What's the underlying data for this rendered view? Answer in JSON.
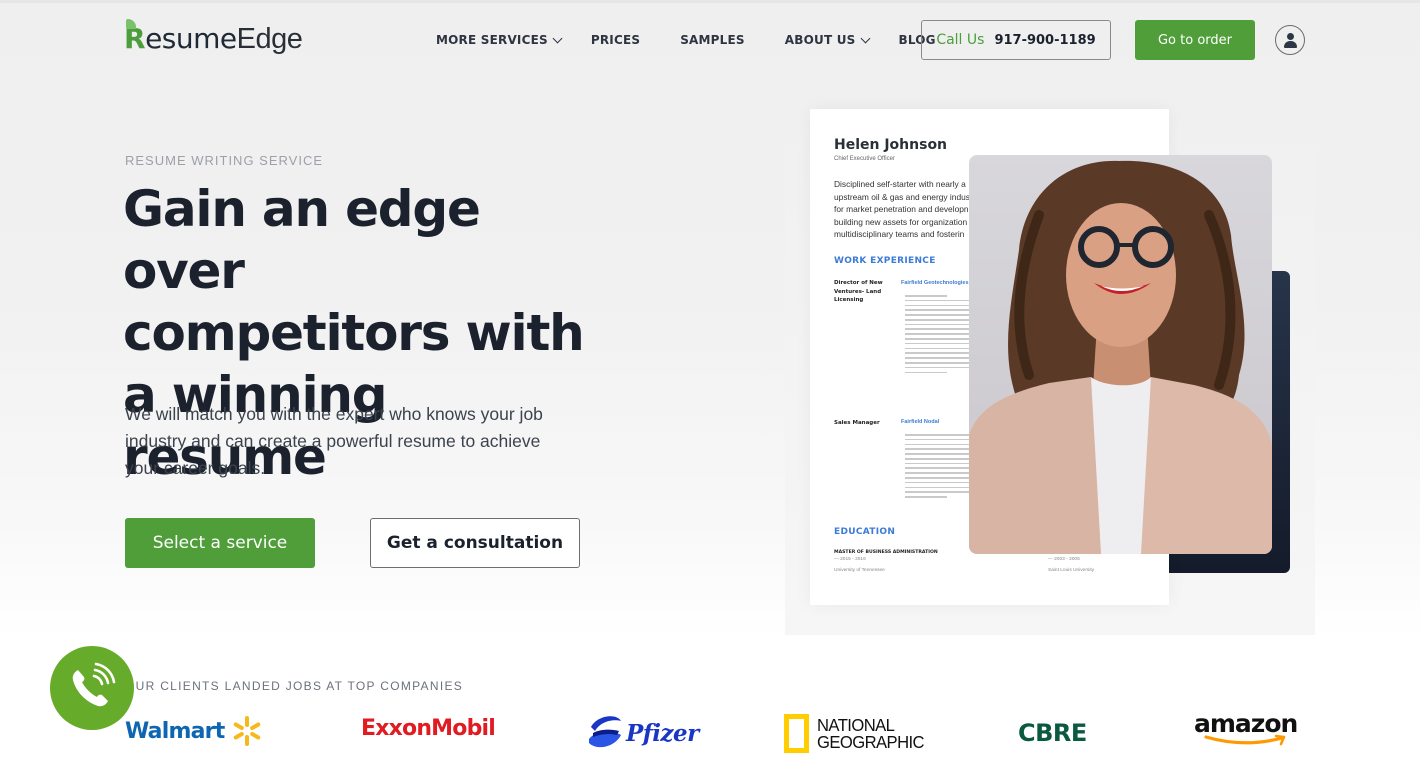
{
  "header": {
    "logo": {
      "r": "R",
      "esume": "esume",
      "edge": "Edge"
    },
    "nav": [
      {
        "label": "MORE SERVICES",
        "has_dropdown": true
      },
      {
        "label": "PRICES",
        "has_dropdown": false
      },
      {
        "label": "SAMPLES",
        "has_dropdown": false
      },
      {
        "label": "ABOUT US",
        "has_dropdown": true
      },
      {
        "label": "BLOG",
        "has_dropdown": false
      }
    ],
    "call": {
      "label": "Call Us",
      "phone": "917-900-1189"
    },
    "order_label": "Go to order",
    "user_icon": "user-icon"
  },
  "hero": {
    "eyebrow": "RESUME WRITING SERVICE",
    "title_lines": [
      "Gain an edge over",
      "competitors with",
      "a winning resume"
    ],
    "subtitle": "We will match you with the expert who knows your job industry and can create a powerful resume to achieve your career goals.",
    "primary_cta": "Select a service",
    "secondary_cta": "Get a consultation"
  },
  "resume_sample": {
    "name": "Helen Johnson",
    "role": "Chief Executive Officer",
    "summary": "Disciplined self-starter with nearly a\nupstream oil & gas and energy indus\nfor market penetration and developn\nbuilding new assets for organization\nmultidisciplinary teams and fosterin",
    "work_heading": "WORK EXPERIENCE",
    "jobs": [
      {
        "title": "Director of New Ventures- Land Licensing",
        "company": "Fairfield Geotechnologies"
      },
      {
        "title": "Sales Manager",
        "company": "Fairfield Nodal"
      }
    ],
    "education_heading": "EDUCATION",
    "education": [
      {
        "degree": "MASTER OF BUSINESS ADMINISTRATION",
        "years": "— 2015 - 2016",
        "school": "University of Tennessee"
      },
      {
        "degree": "",
        "years": "— 2003 - 2006",
        "school": "Saint Louis University"
      }
    ]
  },
  "clients": {
    "label": "OUR CLIENTS LANDED JOBS AT TOP COMPANIES",
    "logos": [
      {
        "name": "Walmart",
        "color": "#0e66b2"
      },
      {
        "name": "ExxonMobil",
        "color": "#e11b22"
      },
      {
        "name": "Pfizer",
        "color": "#1b36c5"
      },
      {
        "name_line1": "NATIONAL",
        "name_line2": "GEOGRAPHIC",
        "color": "#ffcd00"
      },
      {
        "name": "CBRE",
        "color": "#0b5940"
      },
      {
        "name": "amazon",
        "color": "#ff9900"
      }
    ]
  },
  "colors": {
    "brand_green": "#4f9e3a",
    "fab_green": "#66ac2a",
    "text_dark": "#1b222d",
    "resume_blue": "#3c7bd6",
    "dark_card": "#1c2638"
  },
  "call_fab_icon": "phone-icon"
}
